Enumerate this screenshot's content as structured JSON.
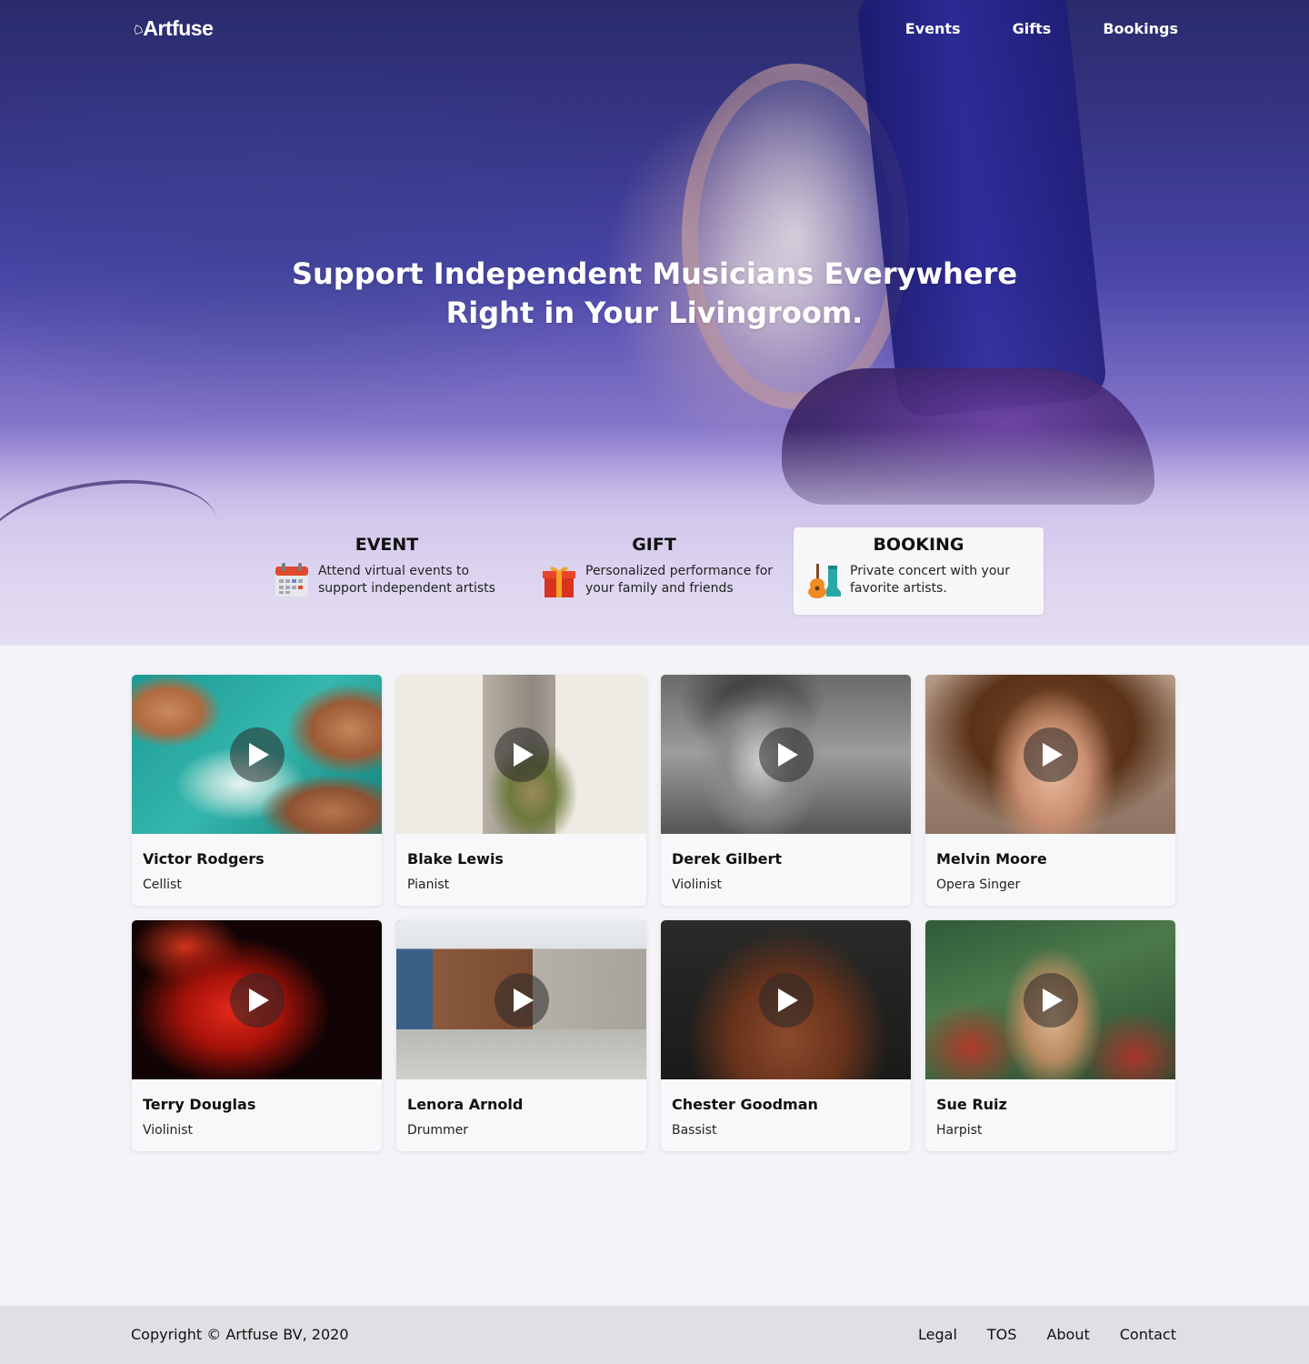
{
  "brand": {
    "logo_text": "Artfuse",
    "logo_icon": "house-mark-icon"
  },
  "nav": {
    "items": [
      {
        "label": "Events"
      },
      {
        "label": "Gifts"
      },
      {
        "label": "Bookings"
      }
    ]
  },
  "hero": {
    "headline_line1": "Support Independent Musicians Everywhere",
    "headline_line2": "Right in Your Livingroom."
  },
  "features": [
    {
      "title": "EVENT",
      "description": "Attend virtual events to support independent artists",
      "icon": "calendar-icon",
      "active": false
    },
    {
      "title": "GIFT",
      "description": "Personalized performance for your family and friends",
      "icon": "gift-icon",
      "active": false
    },
    {
      "title": "BOOKING",
      "description": "Private concert with your favorite artists.",
      "icon": "guitar-boot-icon",
      "active": true
    }
  ],
  "artists": [
    {
      "name": "Victor Rodgers",
      "role": "Cellist",
      "thumb": "aerial-coast-photo"
    },
    {
      "name": "Blake Lewis",
      "role": "Pianist",
      "thumb": "dried-flowers-photo"
    },
    {
      "name": "Derek Gilbert",
      "role": "Violinist",
      "thumb": "bw-portrait-photo"
    },
    {
      "name": "Melvin Moore",
      "role": "Opera Singer",
      "thumb": "curly-hair-portrait-photo"
    },
    {
      "name": "Terry Douglas",
      "role": "Violinist",
      "thumb": "red-neon-glasses-photo"
    },
    {
      "name": "Lenora Arnold",
      "role": "Drummer",
      "thumb": "street-buildings-photo"
    },
    {
      "name": "Chester Goodman",
      "role": "Bassist",
      "thumb": "rust-sculpture-photo"
    },
    {
      "name": "Sue Ruiz",
      "role": "Harpist",
      "thumb": "woman-in-plants-photo"
    }
  ],
  "footer": {
    "copyright": "Copyright © Artfuse BV, 2020",
    "links": [
      {
        "label": "Legal"
      },
      {
        "label": "TOS"
      },
      {
        "label": "About"
      },
      {
        "label": "Contact"
      }
    ]
  }
}
